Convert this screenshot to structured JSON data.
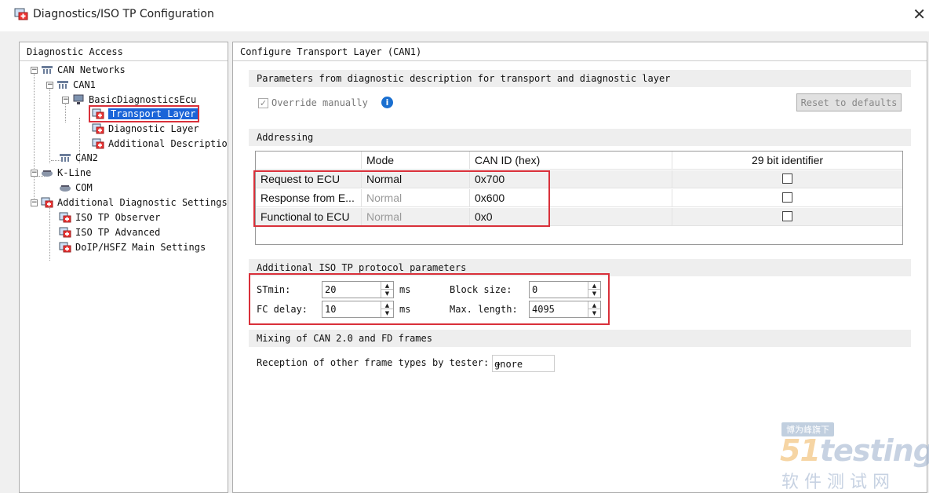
{
  "window": {
    "title": "Diagnostics/ISO TP Configuration",
    "close_glyph": "✕",
    "icon": "config-window-icon"
  },
  "left_panel": {
    "header": "Diagnostic Access",
    "tree": {
      "can_networks": "CAN Networks",
      "can1": "CAN1",
      "ecu": "BasicDiagnosticsEcu",
      "transport_layer": "Transport Layer",
      "diagnostic_layer": "Diagnostic Layer",
      "additional_description": "Additional Descriptio",
      "can2": "CAN2",
      "kline": "K-Line",
      "com": "COM",
      "additional_settings": "Additional Diagnostic Settings",
      "iso_tp_observer": "ISO TP Observer",
      "iso_tp_advanced": "ISO TP Advanced",
      "doip": "DoIP/HSFZ Main Settings",
      "expand_glyph": "−"
    }
  },
  "right_panel": {
    "header": "Configure Transport Layer (CAN1)",
    "params_section": {
      "title": "Parameters from diagnostic description for transport and diagnostic layer",
      "override_label": "Override manually",
      "override_checked": true,
      "check_glyph": "✓",
      "info_glyph": "i",
      "reset_button": "Reset to defaults"
    },
    "addressing": {
      "title": "Addressing",
      "columns": [
        "",
        "Mode",
        "CAN ID (hex)",
        "29 bit identifier"
      ],
      "rows": [
        {
          "name": "Request to ECU",
          "mode": "Normal",
          "can_id": "0x700",
          "bit29": false
        },
        {
          "name": "Response from E...",
          "mode": "Normal",
          "can_id": "0x600",
          "bit29": false
        },
        {
          "name": "Functional to ECU",
          "mode": "Normal",
          "can_id": "0x0",
          "bit29": false
        }
      ]
    },
    "iso_tp": {
      "title": "Additional ISO TP protocol parameters",
      "stmin_label": "STmin:",
      "stmin_value": "20",
      "fc_delay_label": "FC delay:",
      "fc_delay_value": "10",
      "unit_ms": "ms",
      "block_size_label": "Block size:",
      "block_size_value": "0",
      "max_length_label": "Max. length:",
      "max_length_value": "4095",
      "up_glyph": "▲",
      "down_glyph": "▼"
    },
    "mixing": {
      "title": "Mixing of CAN 2.0 and FD frames",
      "reception_label": "Reception of other frame types by tester:",
      "reception_value": "gnore",
      "chevron": "⌄"
    }
  },
  "watermark": {
    "badge": "博为峰旗下",
    "brand_51": "51",
    "brand_rest": "testing",
    "subtitle": "软件测试网"
  }
}
